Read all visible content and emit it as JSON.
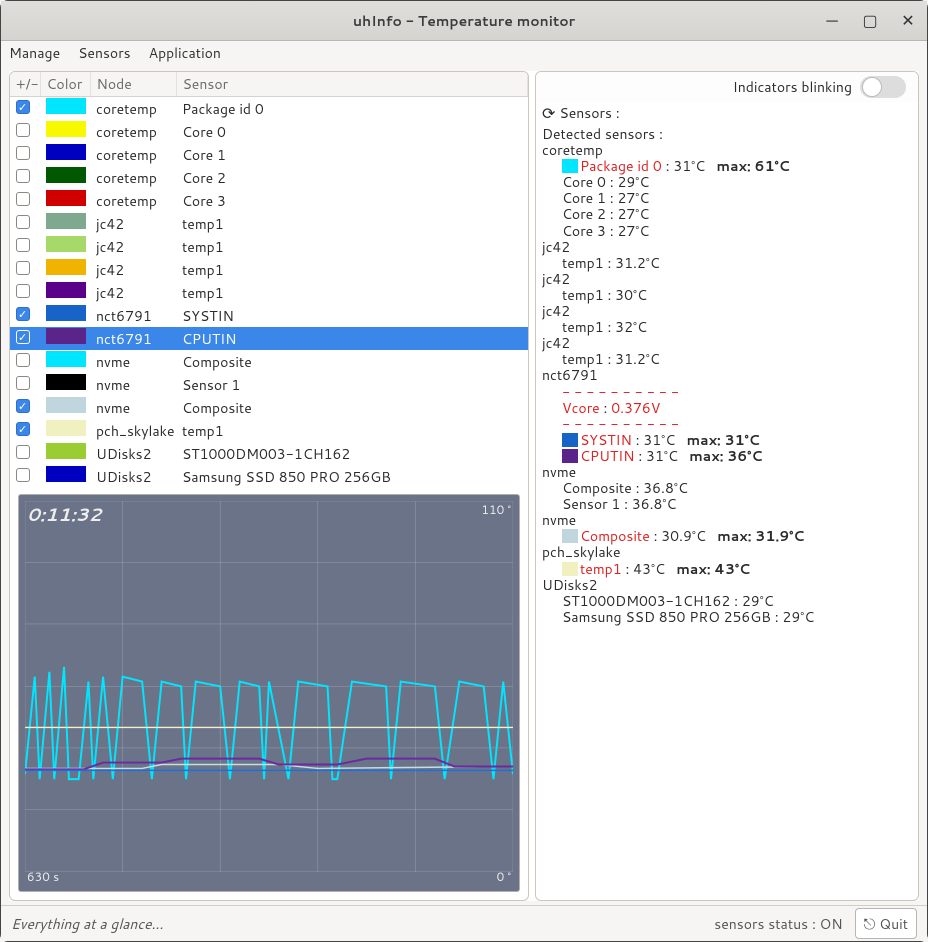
{
  "window": {
    "title": "uhInfo - Temperature monitor"
  },
  "menu": {
    "items": [
      "Manage",
      "Sensors",
      "Application"
    ]
  },
  "columns": {
    "toggle": "+/-",
    "color": "Color",
    "node": "Node",
    "sensor": "Sensor"
  },
  "rows": [
    {
      "checked": true,
      "selected": false,
      "color": "#00e6ff",
      "node": "coretemp",
      "sensor": "Package id 0"
    },
    {
      "checked": false,
      "selected": false,
      "color": "#f8f800",
      "node": "coretemp",
      "sensor": "Core 0"
    },
    {
      "checked": false,
      "selected": false,
      "color": "#0000c0",
      "node": "coretemp",
      "sensor": "Core 1"
    },
    {
      "checked": false,
      "selected": false,
      "color": "#005800",
      "node": "coretemp",
      "sensor": "Core 2"
    },
    {
      "checked": false,
      "selected": false,
      "color": "#d00000",
      "node": "coretemp",
      "sensor": "Core 3"
    },
    {
      "checked": false,
      "selected": false,
      "color": "#7ea890",
      "node": "jc42",
      "sensor": "temp1"
    },
    {
      "checked": false,
      "selected": false,
      "color": "#a6d96a",
      "node": "jc42",
      "sensor": "temp1"
    },
    {
      "checked": false,
      "selected": false,
      "color": "#f0b400",
      "node": "jc42",
      "sensor": "temp1"
    },
    {
      "checked": false,
      "selected": false,
      "color": "#5a008a",
      "node": "jc42",
      "sensor": "temp1"
    },
    {
      "checked": true,
      "selected": false,
      "color": "#1763c7",
      "node": "nct6791",
      "sensor": "SYSTIN"
    },
    {
      "checked": true,
      "selected": true,
      "color": "#5a248a",
      "node": "nct6791",
      "sensor": "CPUTIN"
    },
    {
      "checked": false,
      "selected": false,
      "color": "#00e6ff",
      "node": "nvme",
      "sensor": "Composite"
    },
    {
      "checked": false,
      "selected": false,
      "color": "#000000",
      "node": "nvme",
      "sensor": "Sensor 1"
    },
    {
      "checked": true,
      "selected": false,
      "color": "#bfd6de",
      "node": "nvme",
      "sensor": "Composite"
    },
    {
      "checked": true,
      "selected": false,
      "color": "#f0f0c0",
      "node": "pch_skylake",
      "sensor": "temp1"
    },
    {
      "checked": false,
      "selected": false,
      "color": "#9acd32",
      "node": "UDisks2",
      "sensor": "ST1000DM003-1CH162"
    },
    {
      "checked": false,
      "selected": false,
      "color": "#0000c0",
      "node": "UDisks2",
      "sensor": "Samsung SSD 850 PRO 256GB"
    }
  ],
  "blink_label": "Indicators blinking",
  "sensors_title": "Sensors :",
  "detected_title": "Detected sensors :",
  "detected": [
    {
      "type": "hdr",
      "text": "coretemp"
    },
    {
      "type": "line",
      "swatch": "#00e6ff",
      "label": "Package id 0",
      "label_red": true,
      "temp": "31°C",
      "max": "max: 61°C"
    },
    {
      "type": "line",
      "label": "Core 0",
      "temp": "29°C"
    },
    {
      "type": "line",
      "label": "Core 1",
      "temp": "27°C"
    },
    {
      "type": "line",
      "label": "Core 2",
      "temp": "27°C"
    },
    {
      "type": "line",
      "label": "Core 3",
      "temp": "27°C"
    },
    {
      "type": "hdr",
      "text": "jc42"
    },
    {
      "type": "line",
      "label": "temp1",
      "temp": "31.2°C"
    },
    {
      "type": "hdr",
      "text": "jc42"
    },
    {
      "type": "line",
      "label": "temp1",
      "temp": "30°C"
    },
    {
      "type": "hdr",
      "text": "jc42"
    },
    {
      "type": "line",
      "label": "temp1",
      "temp": "32°C"
    },
    {
      "type": "hdr",
      "text": "jc42"
    },
    {
      "type": "line",
      "label": "temp1",
      "temp": "31.2°C"
    },
    {
      "type": "hdr",
      "text": "nct6791"
    },
    {
      "type": "dashes"
    },
    {
      "type": "vcore",
      "label": "Vcore",
      "value": "0.376V"
    },
    {
      "type": "dashes"
    },
    {
      "type": "line",
      "swatch": "#1763c7",
      "label": "SYSTIN",
      "label_red": true,
      "temp": "31°C",
      "max": "max: 31°C"
    },
    {
      "type": "line",
      "swatch": "#5a248a",
      "label": "CPUTIN",
      "label_red": true,
      "temp": "31°C",
      "max": "max: 36°C"
    },
    {
      "type": "hdr",
      "text": "nvme"
    },
    {
      "type": "line",
      "label": "Composite",
      "temp": "36.8°C"
    },
    {
      "type": "line",
      "label": "Sensor 1",
      "temp": "36.8°C"
    },
    {
      "type": "hdr",
      "text": "nvme"
    },
    {
      "type": "line",
      "swatch": "#bfd6de",
      "label": "Composite",
      "label_red": true,
      "temp": "30.9°C",
      "max": "max: 31.9°C"
    },
    {
      "type": "hdr",
      "text": "pch_skylake"
    },
    {
      "type": "line",
      "swatch": "#f0f0c0",
      "label": "temp1",
      "label_red": true,
      "temp": "43°C",
      "max": "max: 43°C"
    },
    {
      "type": "hdr",
      "text": "UDisks2"
    },
    {
      "type": "line",
      "label": "ST1000DM003-1CH162",
      "temp": "29°C"
    },
    {
      "type": "line",
      "label": "Samsung SSD 850 PRO 256GB",
      "temp": "29°C"
    }
  ],
  "graph": {
    "uptime": "0:11:32",
    "seconds": "630 s",
    "deg_top": "110 °",
    "deg_bot": "0 °"
  },
  "status": {
    "left": "Everything at a glance...",
    "sensors": "sensors status : ON",
    "quit": "Quit"
  },
  "chart_data": {
    "type": "line",
    "ylim": [
      0,
      110
    ],
    "xrange_seconds": 630,
    "note": "approximate temperatures over time window",
    "series": [
      {
        "name": "Package id 0",
        "color": "#00e6ff",
        "approx_range_c": [
          28,
          61
        ],
        "typical_c": 40
      },
      {
        "name": "SYSTIN",
        "color": "#1763c7",
        "approx_range_c": [
          30,
          31
        ],
        "typical_c": 31
      },
      {
        "name": "CPUTIN",
        "color": "#5a248a",
        "approx_range_c": [
          30,
          36
        ],
        "typical_c": 31
      },
      {
        "name": "nvme Composite",
        "color": "#bfd6de",
        "approx_range_c": [
          30,
          32
        ],
        "typical_c": 31
      },
      {
        "name": "pch temp1",
        "color": "#f0f0c0",
        "approx_range_c": [
          42,
          43
        ],
        "typical_c": 43
      }
    ]
  }
}
